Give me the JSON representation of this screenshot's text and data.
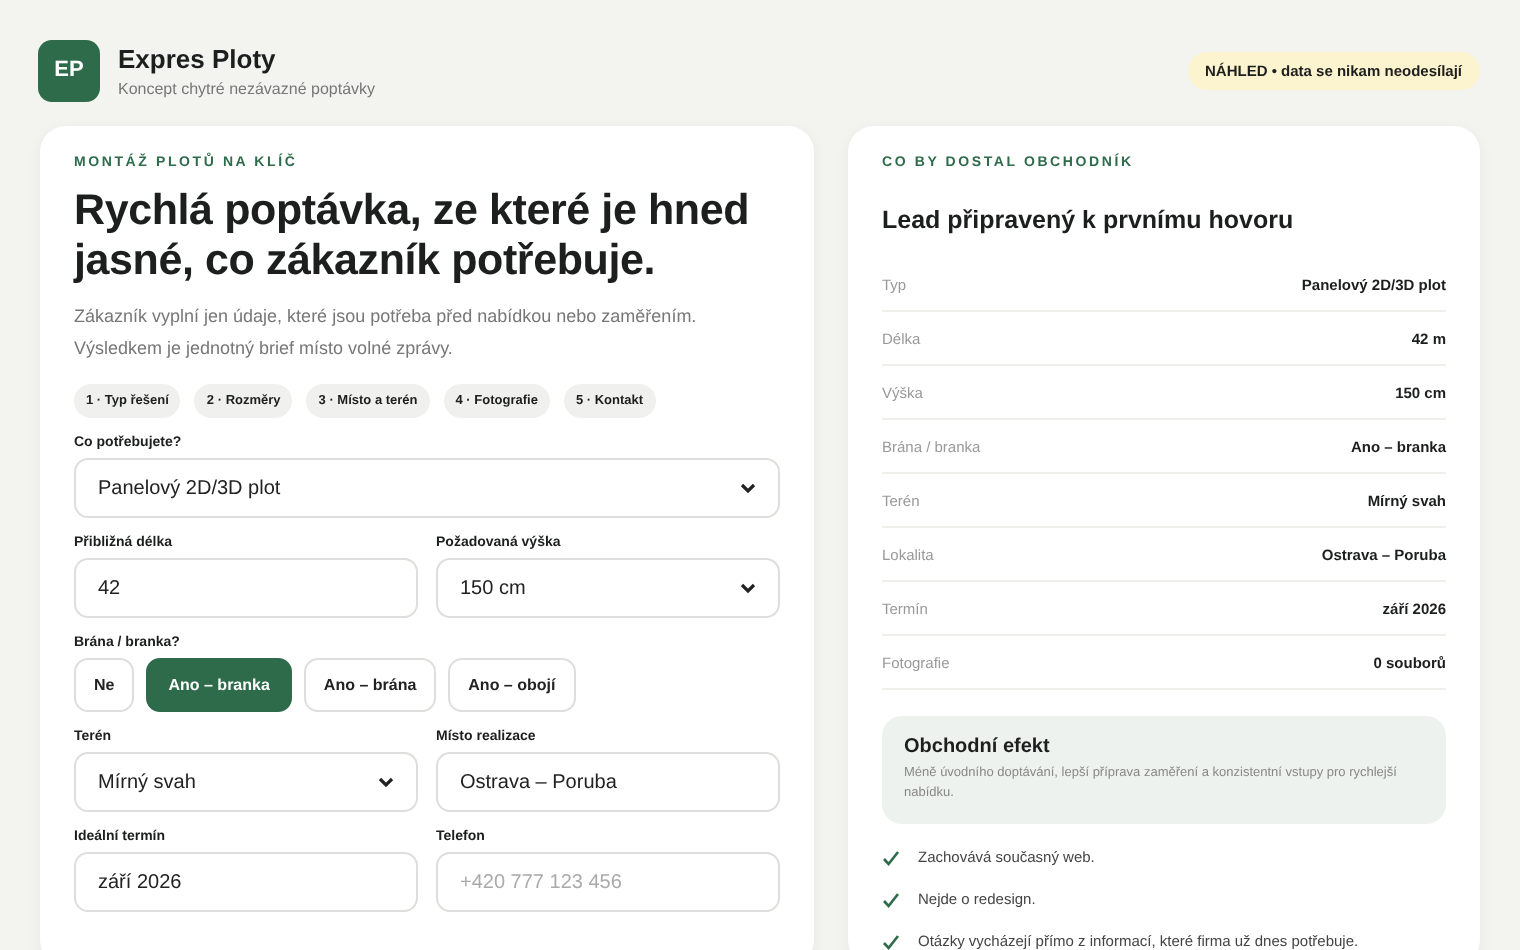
{
  "header": {
    "logo": "EP",
    "title": "Expres Ploty",
    "subtitle": "Koncept chytré nezávazné poptávky",
    "badge": "**NÁHLED** • data se nikam neodesílají"
  },
  "form": {
    "eyebrow": "MONTÁŽ PLOTŮ NA KLÍČ",
    "title": "Rychlá poptávka, ze které je hned jasné, co zákazník potřebuje.",
    "intro": "Zákazník vyplní jen údaje, které jsou potřeba před nabídkou nebo zaměřením. Výsledkem je jednotný brief místo volné zprávy.",
    "steps": [
      "1 · Typ řešení",
      "2 · Rozměry",
      "3 · Místo a terén",
      "4 · Fotografie",
      "5 · Kontakt"
    ],
    "rows": [
      [
        {
          "kind": "select",
          "label": "Co potřebujete?",
          "value": "Panelový 2D/3D plot"
        }
      ],
      [
        {
          "kind": "text",
          "label": "Přibližná délka",
          "value": "42"
        },
        {
          "kind": "select",
          "label": "Požadovaná výška",
          "value": "150 cm"
        }
      ],
      [
        {
          "kind": "choice",
          "label": "Brána / branka?",
          "options": [
            {
              "label": "Ne",
              "selected": false
            },
            {
              "label": "Ano – branka",
              "selected": true
            },
            {
              "label": "Ano – brána",
              "selected": false
            },
            {
              "label": "Ano – obojí",
              "selected": false
            }
          ]
        }
      ],
      [
        {
          "kind": "select",
          "label": "Terén",
          "value": "Mírný svah"
        },
        {
          "kind": "text",
          "label": "Místo realizace",
          "value": "Ostrava – Poruba"
        }
      ],
      [
        {
          "kind": "text",
          "label": "Ideální termín",
          "value": "září 2026"
        },
        {
          "kind": "text",
          "label": "Telefon",
          "placeholder": "+420 777 123 456"
        }
      ]
    ]
  },
  "summary": {
    "eyebrow": "CO BY DOSTAL OBCHODNÍK",
    "title": "Lead připravený k prvnímu hovoru",
    "rows": [
      {
        "label": "Typ",
        "value": "Panelový 2D/3D plot"
      },
      {
        "label": "Délka",
        "value": "42 m"
      },
      {
        "label": "Výška",
        "value": "150 cm"
      },
      {
        "label": "Brána / branka",
        "value": "Ano – branka"
      },
      {
        "label": "Terén",
        "value": "Mírný svah"
      },
      {
        "label": "Lokalita",
        "value": "Ostrava – Poruba"
      },
      {
        "label": "Termín",
        "value": "září 2026"
      },
      {
        "label": "Fotografie",
        "value": "0 souborů"
      }
    ],
    "effect": {
      "title": "Obchodní efekt",
      "text": "Méně úvodního doptávání, lepší příprava zaměření a konzistentní vstupy pro rychlejší nabídku."
    },
    "checks": [
      "Zachovává současný web.",
      "Nejde o redesign.",
      "Otázky vycházejí přímo z informací, které firma už dnes potřebuje."
    ]
  }
}
